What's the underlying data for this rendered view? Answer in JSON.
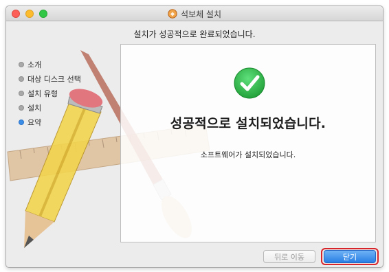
{
  "window": {
    "title": "석보체 설치",
    "icon": "installer-package-icon"
  },
  "header": {
    "subtitle": "설치가 성공적으로 완료되었습니다."
  },
  "steps": [
    {
      "label": "소개",
      "active": false
    },
    {
      "label": "대상 디스크 선택",
      "active": false
    },
    {
      "label": "설치 유형",
      "active": false
    },
    {
      "label": "설치",
      "active": false
    },
    {
      "label": "요약",
      "active": true
    }
  ],
  "main": {
    "status_icon": "checkmark-circle-icon",
    "heading": "성공적으로 설치되었습니다.",
    "message": "소프트웨어가 설치되었습니다."
  },
  "buttons": {
    "back_label": "뒤로 이동",
    "close_label": "닫기"
  },
  "colors": {
    "accent": "#2a7fe4",
    "success": "#2fbf4a",
    "highlight": "#d7242a",
    "active_step": "#3b8ee8"
  }
}
